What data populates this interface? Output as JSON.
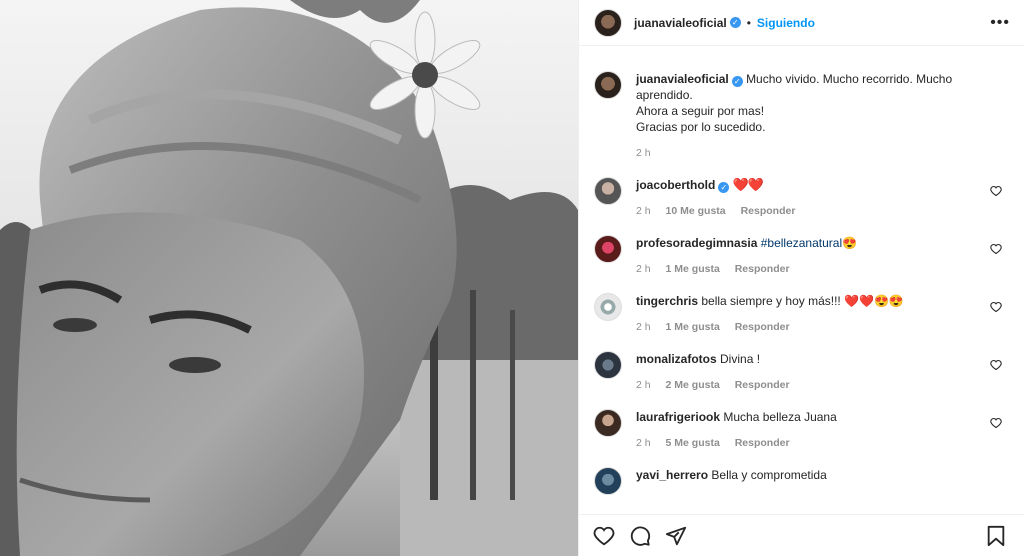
{
  "post": {
    "author": "juanavialeoficial",
    "follow_status": "Siguiendo",
    "separator": "•",
    "caption_lines": [
      "Mucho vivido. Mucho recorrido. Mucho aprendido.",
      "Ahora a seguir por mas!",
      "Gracias por lo sucedido."
    ],
    "caption_time": "2 h"
  },
  "comments": [
    {
      "user": "joacoberthold",
      "verified": true,
      "text": "❤️❤️",
      "time": "2 h",
      "likes": "10 Me gusta",
      "reply": "Responder"
    },
    {
      "user": "profesoradegimnasia",
      "verified": false,
      "text": "#bellezanatural😍",
      "time": "2 h",
      "likes": "1 Me gusta",
      "reply": "Responder"
    },
    {
      "user": "tingerchris",
      "verified": false,
      "text": "bella siempre y hoy más!!! ❤️❤️😍😍",
      "time": "2 h",
      "likes": "1 Me gusta",
      "reply": "Responder"
    },
    {
      "user": "monalizafotos",
      "verified": false,
      "text": "Divina !",
      "time": "2 h",
      "likes": "2 Me gusta",
      "reply": "Responder"
    },
    {
      "user": "laurafrigeriook",
      "verified": false,
      "text": "Mucha belleza Juana",
      "time": "2 h",
      "likes": "5 Me gusta",
      "reply": "Responder"
    },
    {
      "user": "yavi_herrero",
      "verified": false,
      "text": "Bella y comprometida",
      "time": "",
      "likes": "",
      "reply": ""
    }
  ],
  "icons": {
    "like": "heart-icon",
    "comment": "comment-icon",
    "share": "share-icon",
    "save": "bookmark-icon",
    "more": "more-options-icon",
    "verified": "verified-badge-icon"
  },
  "colors": {
    "link_blue": "#0095f6",
    "verified_blue": "#3897f0",
    "meta_gray": "#8e8e8e"
  }
}
